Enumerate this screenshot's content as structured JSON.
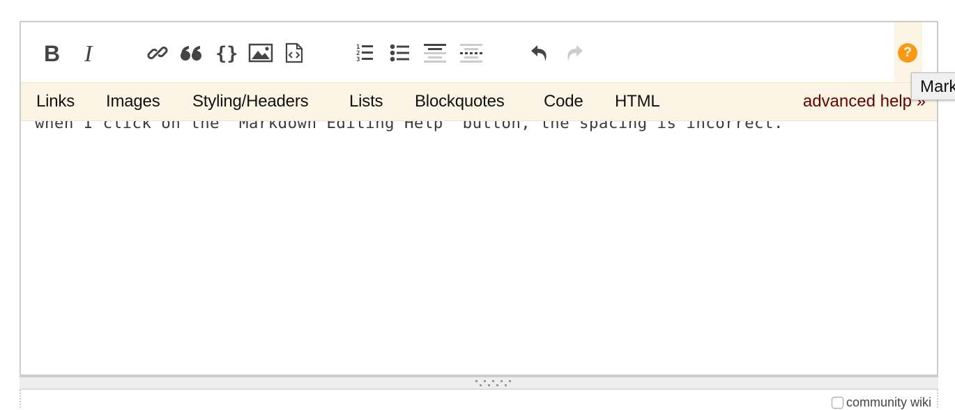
{
  "toolbar": {
    "buttons": [
      {
        "name": "bold",
        "icon": "bold-icon"
      },
      {
        "name": "italic",
        "icon": "italic-icon"
      },
      {
        "name": "link",
        "icon": "link-icon"
      },
      {
        "name": "blockquote",
        "icon": "quote-icon"
      },
      {
        "name": "code",
        "icon": "braces-icon"
      },
      {
        "name": "image",
        "icon": "image-icon"
      },
      {
        "name": "snippet",
        "icon": "code-file-icon"
      },
      {
        "name": "ordered-list",
        "icon": "numbered-list-icon"
      },
      {
        "name": "bulleted-list",
        "icon": "bullet-list-icon"
      },
      {
        "name": "heading",
        "icon": "heading-icon"
      },
      {
        "name": "horizontal-rule",
        "icon": "horizontal-rule-icon"
      },
      {
        "name": "undo",
        "icon": "undo-icon",
        "enabled": true
      },
      {
        "name": "redo",
        "icon": "redo-icon",
        "enabled": false
      }
    ],
    "help_button": {
      "label": "?",
      "icon": "help-circle-icon",
      "color": "#f99a16"
    }
  },
  "help_strip": {
    "tabs": [
      "Links",
      "Images",
      "Styling/Headers",
      "Lists",
      "Blockquotes",
      "Code",
      "HTML"
    ],
    "advanced_help": "advanced help »"
  },
  "tooltip": {
    "text": "Mark"
  },
  "editor": {
    "text": "when I click on the `Markdown Editing Help` button, the spacing is incorrect."
  },
  "footer": {
    "left_text": "",
    "community_wiki_label": "community wiki",
    "community_wiki_checked": false
  },
  "colors": {
    "help_strip_bg": "#fcf5e5",
    "advanced_help_link": "#660000",
    "icon_dark": "#444444",
    "icon_light": "#cccccc"
  }
}
